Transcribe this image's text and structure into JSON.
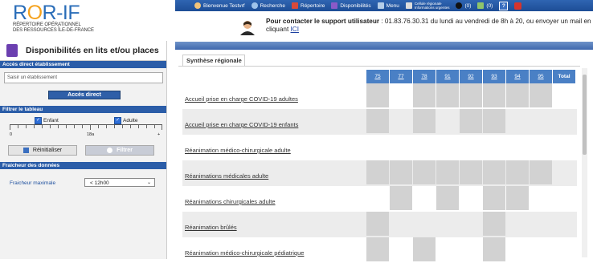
{
  "logo": {
    "name_pre": "R",
    "name_o": "O",
    "name_post": "R-IF",
    "sub1": "RÉPERTOIRE OPÉRATIONNEL",
    "sub2": "DES RESSOURCES ÎLE-DE-FRANCE"
  },
  "topnav": {
    "welcome": "Bienvenue Testvrf",
    "search": "Recherche",
    "directory": "Répertoire",
    "availability": "Disponibilités",
    "menu": "Menu",
    "alerts_line1": "Cellule régionale",
    "alerts_line2": "Informations urgentes",
    "count1": "(0)",
    "count2": "(0)",
    "help": "?"
  },
  "support": {
    "bold": "Pour contacter le support utilisateur",
    "rest": " : 01.83.76.30.31 du lundi au vendredi de 8h à 20, ou envoyer un mail en cliquant ",
    "link": "ICI"
  },
  "sidebar": {
    "title": "Disponibilités en lits et/ou places",
    "direct_section": "Accès direct établissement",
    "estab_placeholder": "Saisir un établissement",
    "direct_button": "Accès direct",
    "filter_section": "Filtrer le tableau",
    "child_label": "Enfant",
    "adult_label": "Adulte",
    "tick_start": "0",
    "tick_mid": "18a",
    "tick_end": "+",
    "reset_button": "Réinitialiser",
    "filter_button": "Filtrer",
    "freshness_section": "Fraicheur des données",
    "freshness_label": "Fraicheur maximale",
    "freshness_value": "< 12h00"
  },
  "main": {
    "tab": "Synthèse régionale",
    "columns": [
      "75",
      "77",
      "78",
      "91",
      "92",
      "93",
      "94",
      "95",
      "Total"
    ],
    "rows": [
      {
        "label": "Accueil prise en charge COVID-19 adultes",
        "cells": [
          "#d2d2d2",
          "#ffffff",
          "#d2d2d2",
          "#d2d2d2",
          "#d2d2d2",
          "#d2d2d2",
          "#d2d2d2",
          "#d2d2d2",
          "#ffffff"
        ]
      },
      {
        "label": "Accueil prise en charge COVID-19 enfants",
        "cells": [
          "#d2d2d2",
          "#ececec",
          "#d2d2d2",
          "#ececec",
          "#d2d2d2",
          "#d2d2d2",
          "#ececec",
          "#ececec",
          "#ececec"
        ]
      },
      {
        "label": "Réanimation médico-chirurgicale adulte",
        "cells": [
          "#ffffff",
          "#ffffff",
          "#ffffff",
          "#ffffff",
          "#ffffff",
          "#ffffff",
          "#ffffff",
          "#ffffff",
          "#ffffff"
        ]
      },
      {
        "label": "Réanimations médicales adulte",
        "cells": [
          "#d2d2d2",
          "#d2d2d2",
          "#d2d2d2",
          "#d2d2d2",
          "#d2d2d2",
          "#d2d2d2",
          "#d2d2d2",
          "#d2d2d2",
          "#ececec"
        ]
      },
      {
        "label": "Réanimations chirurgicales adulte",
        "cells": [
          "#ffffff",
          "#d2d2d2",
          "#ffffff",
          "#d2d2d2",
          "#ffffff",
          "#d2d2d2",
          "#d2d2d2",
          "#ffffff",
          "#ffffff"
        ]
      },
      {
        "label": "Réanimation brûlés",
        "cells": [
          "#d2d2d2",
          "#ececec",
          "#ececec",
          "#ececec",
          "#ececec",
          "#d2d2d2",
          "#ececec",
          "#ececec",
          "#ececec"
        ]
      },
      {
        "label": "Réanimation médico-chirurgicale pédiatrique",
        "cells": [
          "#d2d2d2",
          "#ffffff",
          "#d2d2d2",
          "#ffffff",
          "#ffffff",
          "#d2d2d2",
          "#ffffff",
          "#ffffff",
          "#ffffff"
        ]
      }
    ]
  },
  "colors": {
    "nav_blue": "#1d4d96",
    "accent": "#4a80c5",
    "brand_orange": "#f5a21d"
  }
}
